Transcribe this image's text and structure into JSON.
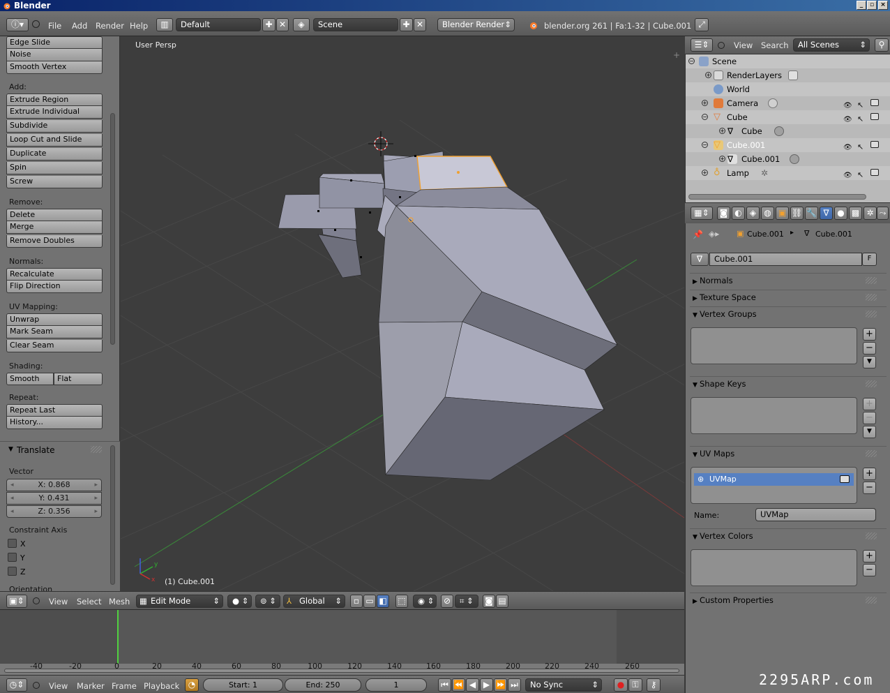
{
  "app": {
    "title": "Blender",
    "version_info": "blender.org 261 | Fa:1-32 | Cube.001",
    "watermark": "2295ARP.com"
  },
  "topbar": {
    "menus": [
      "File",
      "Add",
      "Render",
      "Help"
    ],
    "screen_layout": "Default",
    "scene": "Scene",
    "render_engine": "Blender Render"
  },
  "toolshelf": {
    "deform_items": [
      "Edge Slide",
      "Noise",
      "Smooth Vertex"
    ],
    "add_label": "Add:",
    "add_items": [
      "Extrude Region",
      "Extrude Individual",
      "Subdivide",
      "Loop Cut and Slide",
      "Duplicate",
      "Spin",
      "Screw"
    ],
    "remove_label": "Remove:",
    "remove_items": [
      "Delete",
      "Merge",
      "Remove Doubles"
    ],
    "normals_label": "Normals:",
    "normals_items": [
      "Recalculate",
      "Flip Direction"
    ],
    "uv_label": "UV Mapping:",
    "uv_items": [
      "Unwrap",
      "Mark Seam",
      "Clear Seam"
    ],
    "shading_label": "Shading:",
    "shading_smooth": "Smooth",
    "shading_flat": "Flat",
    "repeat_label": "Repeat:",
    "repeat_items": [
      "Repeat Last",
      "History..."
    ],
    "operator": {
      "title": "Translate",
      "vector_label": "Vector",
      "x": "X: 0.868",
      "y": "Y: 0.431",
      "z": "Z: 0.356",
      "constraint_label": "Constraint Axis",
      "axes": [
        "X",
        "Y",
        "Z"
      ],
      "orientation_label": "Orientation"
    }
  },
  "viewport": {
    "view_name": "User Persp",
    "object_label": "(1) Cube.001"
  },
  "view_header": {
    "menus": [
      "View",
      "Select",
      "Mesh"
    ],
    "mode": "Edit Mode",
    "orientation": "Global"
  },
  "timeline": {
    "ticks": [
      "-40",
      "-20",
      "0",
      "20",
      "40",
      "60",
      "80",
      "100",
      "120",
      "140",
      "160",
      "180",
      "200",
      "220",
      "240",
      "260"
    ],
    "menus": [
      "View",
      "Marker",
      "Frame",
      "Playback"
    ],
    "start": "Start: 1",
    "end": "End: 250",
    "current": "1",
    "sync": "No Sync"
  },
  "outliner": {
    "menus": [
      "View",
      "Search"
    ],
    "filter": "All Scenes",
    "rows": {
      "scene": "Scene",
      "renderlayers": "RenderLayers",
      "world": "World",
      "camera": "Camera",
      "cube": "Cube",
      "cube_mesh": "Cube",
      "cube001": "Cube.001",
      "cube001_mesh": "Cube.001",
      "lamp": "Lamp"
    }
  },
  "properties": {
    "breadcrumb_object": "Cube.001",
    "breadcrumb_mesh": "Cube.001",
    "datablock_name": "Cube.001",
    "fake_user": "F",
    "panels": {
      "normals": "Normals",
      "texture_space": "Texture Space",
      "vertex_groups": "Vertex Groups",
      "shape_keys": "Shape Keys",
      "uv_maps": "UV Maps",
      "vertex_colors": "Vertex Colors",
      "custom_properties": "Custom Properties"
    },
    "uv_map_item": "UVMap",
    "name_label": "Name:",
    "name_value": "UVMap"
  },
  "colors": {
    "accent_blue": "#5680c2",
    "selection_orange": "#f0a030",
    "mesh_face": "#a6a6b8"
  }
}
